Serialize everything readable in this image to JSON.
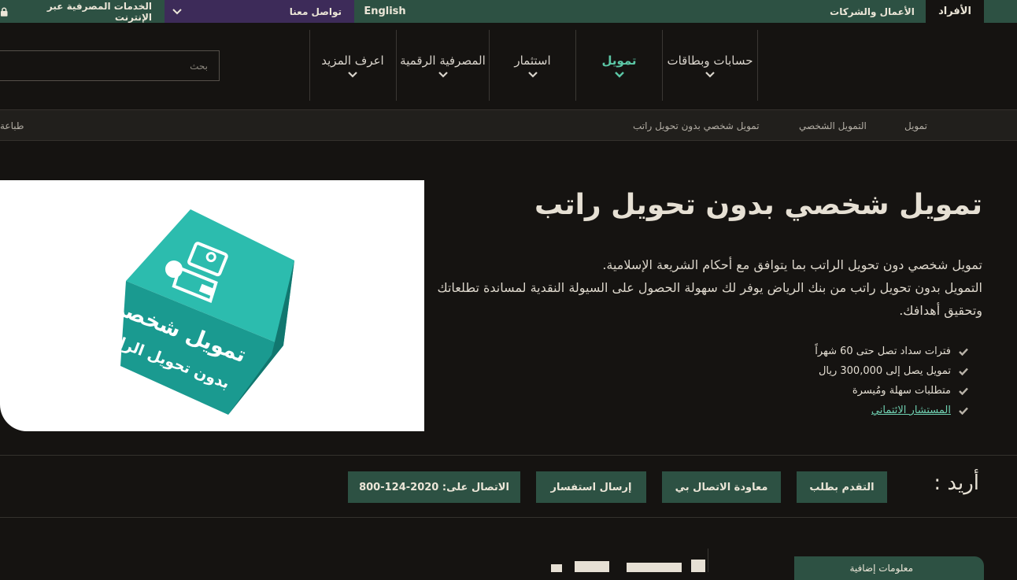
{
  "topbar": {
    "online_banking": "الخدمات المصرفية عبر الإنترنت",
    "contact_us": "تواصل معنا",
    "english": "English",
    "business": "الأعمال والشركات",
    "individuals": "الأفراد",
    "colors": {
      "bar": "#2d5143",
      "contact_bg": "#3d2b59"
    }
  },
  "nav": {
    "search_placeholder": "بحث",
    "items": [
      {
        "label": "حسابات وبطاقات"
      },
      {
        "label": "تمويل",
        "active": true
      },
      {
        "label": "استثمار"
      },
      {
        "label": "المصرفية الرقمية"
      },
      {
        "label": "اعرف المزيد"
      }
    ],
    "accent_color": "#5cc7a6"
  },
  "breadcrumb": {
    "items": [
      "تمويل",
      "التمويل الشخصي",
      "تمويل شخصي بدون تحويل راتب"
    ],
    "print": "طباعة"
  },
  "hero": {
    "title": "تمويل شخصي بدون تحويل راتب",
    "description_line1": "تمويل شخصي دون تحويل الراتب بما يتوافق مع أحكام الشريعة الإسلامية.",
    "description_line2": "التمويل بدون تحويل راتب من بنك الرياض يوفر لك سهولة الحصول على السيولة النقدية لمساندة تطلعاتك وتحقيق أهدافك.",
    "features": [
      "فترات سداد تصل حتى 60 شهراً",
      "تمويل يصل إلى 300,000 ريال",
      "متطلبات سهلة ومُيسرة"
    ],
    "advisor_link": "المستشار الائتماني",
    "image_text_line1": "تمويل شخصي",
    "image_text_line2": "بدون تحويل الراتب",
    "cube_color": "#1a9a90"
  },
  "cta": {
    "want_label": "أريد :",
    "apply": "التقدم بطلب",
    "callback": "معاودة الاتصال بي",
    "inquiry": "إرسال استفسار",
    "call": "الاتصال على: 2020-124-800"
  },
  "bottom": {
    "more_info": "معلومات إضافية"
  }
}
